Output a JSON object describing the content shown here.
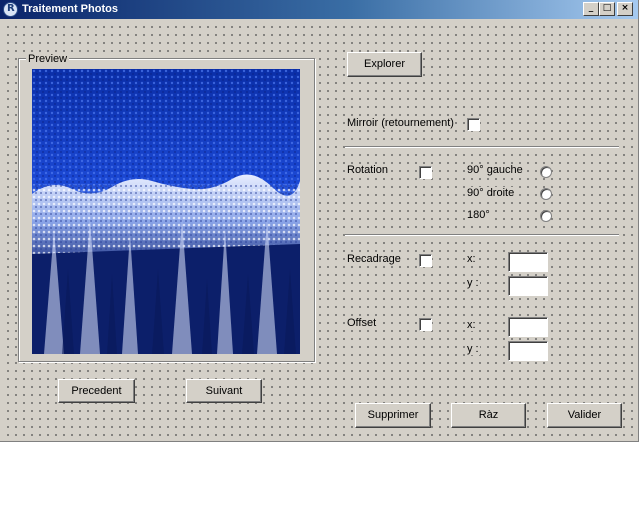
{
  "window": {
    "title": "Traitement Photos",
    "controls": {
      "minimize": "_",
      "maximize": "□",
      "close": "×"
    }
  },
  "preview": {
    "label": "Preview",
    "image_subject": "snowy blue forest photograph"
  },
  "buttons": {
    "explorer": "Explorer",
    "precedent": "Precedent",
    "suivant": "Suivant",
    "supprimer": "Supprimer",
    "raz": "Ràz",
    "valider": "Valider"
  },
  "miroir": {
    "label": "Mirroir (retournement)",
    "checked": false
  },
  "rotation": {
    "label": "Rotation",
    "checked": false,
    "options": [
      {
        "label": "90° gauche",
        "selected": false
      },
      {
        "label": "90° droite",
        "selected": false
      },
      {
        "label": "180°",
        "selected": false
      }
    ]
  },
  "recadrage": {
    "label": "Recadrage",
    "checked": false,
    "x_label": "x:",
    "y_label": "y :",
    "x_value": "",
    "y_value": ""
  },
  "offset": {
    "label": "Offset",
    "checked": false,
    "x_label": "x:",
    "y_label": "y :",
    "x_value": "",
    "y_value": ""
  },
  "colors": {
    "face": "#d4d0c8",
    "title_start": "#0a246a",
    "title_end": "#a6caf0"
  }
}
